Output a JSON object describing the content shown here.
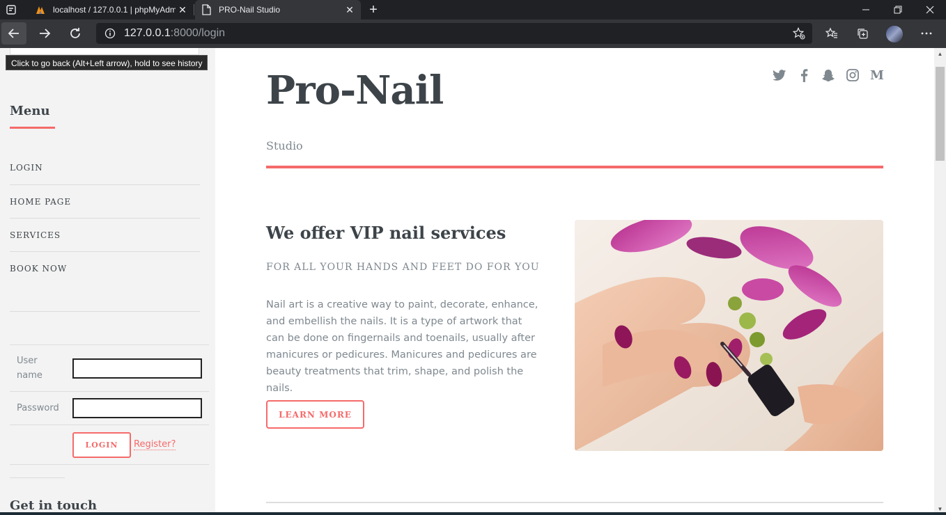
{
  "browser": {
    "tabs": [
      {
        "title": "localhost / 127.0.0.1 | phpMyAdmin",
        "close": "✕"
      },
      {
        "title": "PRO-Nail Studio",
        "close": "✕"
      }
    ],
    "new_tab": "+",
    "url_host": "127.0.0.1",
    "url_path": ":8000/login",
    "tooltip": "Click to go back (Alt+Left arrow), hold to see history"
  },
  "sidebar": {
    "menu_title": "Menu",
    "items": [
      {
        "label": "LOGIN"
      },
      {
        "label": "HOME PAGE"
      },
      {
        "label": "SERVICES"
      },
      {
        "label": "BOOK NOW"
      }
    ],
    "login": {
      "username_label": "User name",
      "password_label": "Password",
      "username_value": "",
      "password_value": "",
      "login_button": "LOGIN",
      "register_link": "Register?"
    },
    "get_in_touch": "Get in touch"
  },
  "header": {
    "logo": "Pro-Nail",
    "subtitle": "Studio",
    "social": [
      "twitter-icon",
      "facebook-icon",
      "snapchat-icon",
      "instagram-icon",
      "medium-icon"
    ],
    "social_medium_glyph": "M"
  },
  "hero": {
    "title": "We offer VIP nail services",
    "subtitle": "FOR ALL YOUR HANDS AND FEET DO FOR YOU",
    "text": "Nail art is a creative way to paint, decorate, enhance, and embellish the nails. It is a type of artwork that can be done on fingernails and toenails, usually after manicures or pedicures. Manicures and pedicures are beauty treatments that trim, shape, and polish the nails.",
    "button": "LEARN MORE"
  },
  "colors": {
    "accent": "#f56a6a",
    "heading": "#3d4449",
    "text": "#7f888f",
    "sidebar_bg": "#f3f3f3"
  }
}
